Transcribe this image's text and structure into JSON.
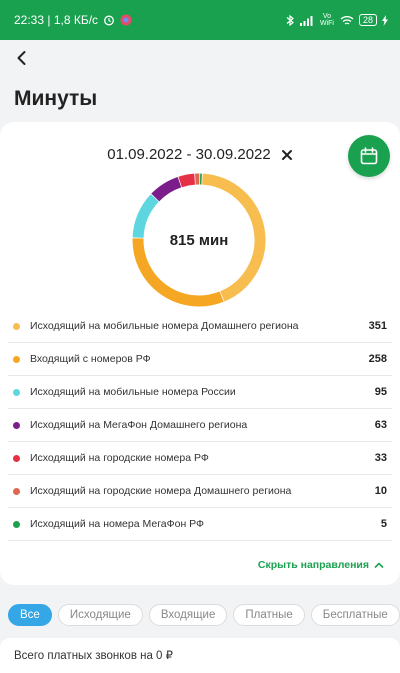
{
  "status": {
    "time_speed": "22:33 | 1,8 КБ/с",
    "network": "Vo WiFi",
    "battery": "28"
  },
  "header": {
    "title": "Минуты"
  },
  "period": {
    "range": "01.09.2022 - 30.09.2022"
  },
  "total": "815 мин",
  "chart_data": {
    "type": "pie",
    "categories": [
      "Исходящий на мобильные номера Домашнего региона",
      "Входящий с номеров РФ",
      "Исходящий на мобильные номера России",
      "Исходящий на МегаФон Домашнего региона",
      "Исходящий на городские номера РФ",
      "Исходящий на городские номера Домашнего региона",
      "Исходящий на номера МегаФон РФ"
    ],
    "values": [
      351,
      258,
      95,
      63,
      33,
      10,
      5
    ],
    "colors": [
      "#f8bd4f",
      "#f5a623",
      "#5ed6e0",
      "#7b1e8c",
      "#e53046",
      "#e0674f",
      "#1aa150"
    ],
    "title": "815 мин"
  },
  "toggle": {
    "label": "Скрыть направления"
  },
  "filters": [
    "Все",
    "Исходящие",
    "Входящие",
    "Платные",
    "Бесплатные"
  ],
  "summary": "Всего платных звонков на 0 ₽"
}
